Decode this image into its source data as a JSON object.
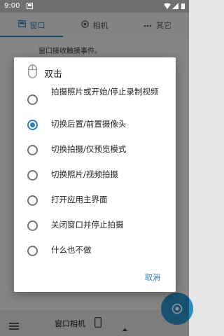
{
  "status_bar": {
    "time": "9:00"
  },
  "tabs": [
    {
      "label": "窗口",
      "active": true
    },
    {
      "label": "相机",
      "active": false
    },
    {
      "label": "其它",
      "active": false
    }
  ],
  "background": {
    "text": "窗口接收触摸事件。"
  },
  "bottom_bar": {
    "label": "窗口相机"
  },
  "dialog": {
    "title": "双击",
    "options": [
      {
        "label": "拍摄照片或开始/停止录制视频",
        "checked": false
      },
      {
        "label": "切换后置/前置摄像头",
        "checked": true
      },
      {
        "label": "切换拍摄/仅预览模式",
        "checked": false
      },
      {
        "label": "切换照片/视频拍摄",
        "checked": false
      },
      {
        "label": "打开应用主界面",
        "checked": false
      },
      {
        "label": "关闭窗口并停止拍摄",
        "checked": false
      },
      {
        "label": "什么也不做",
        "checked": false
      }
    ],
    "cancel_label": "取消"
  },
  "colors": {
    "accent": "#2a7db5",
    "fab": "#2b8ec2"
  },
  "icons": {
    "tab_window": "window-icon",
    "tab_camera": "aperture-icon",
    "tab_other": "more-icon",
    "dialog_title": "mouse-icon",
    "bottom_menu": "menu-icon",
    "bottom_phone": "phone-rotate-icon",
    "bottom_dropdown": "caret-up-icon",
    "fab": "camera-icon"
  }
}
